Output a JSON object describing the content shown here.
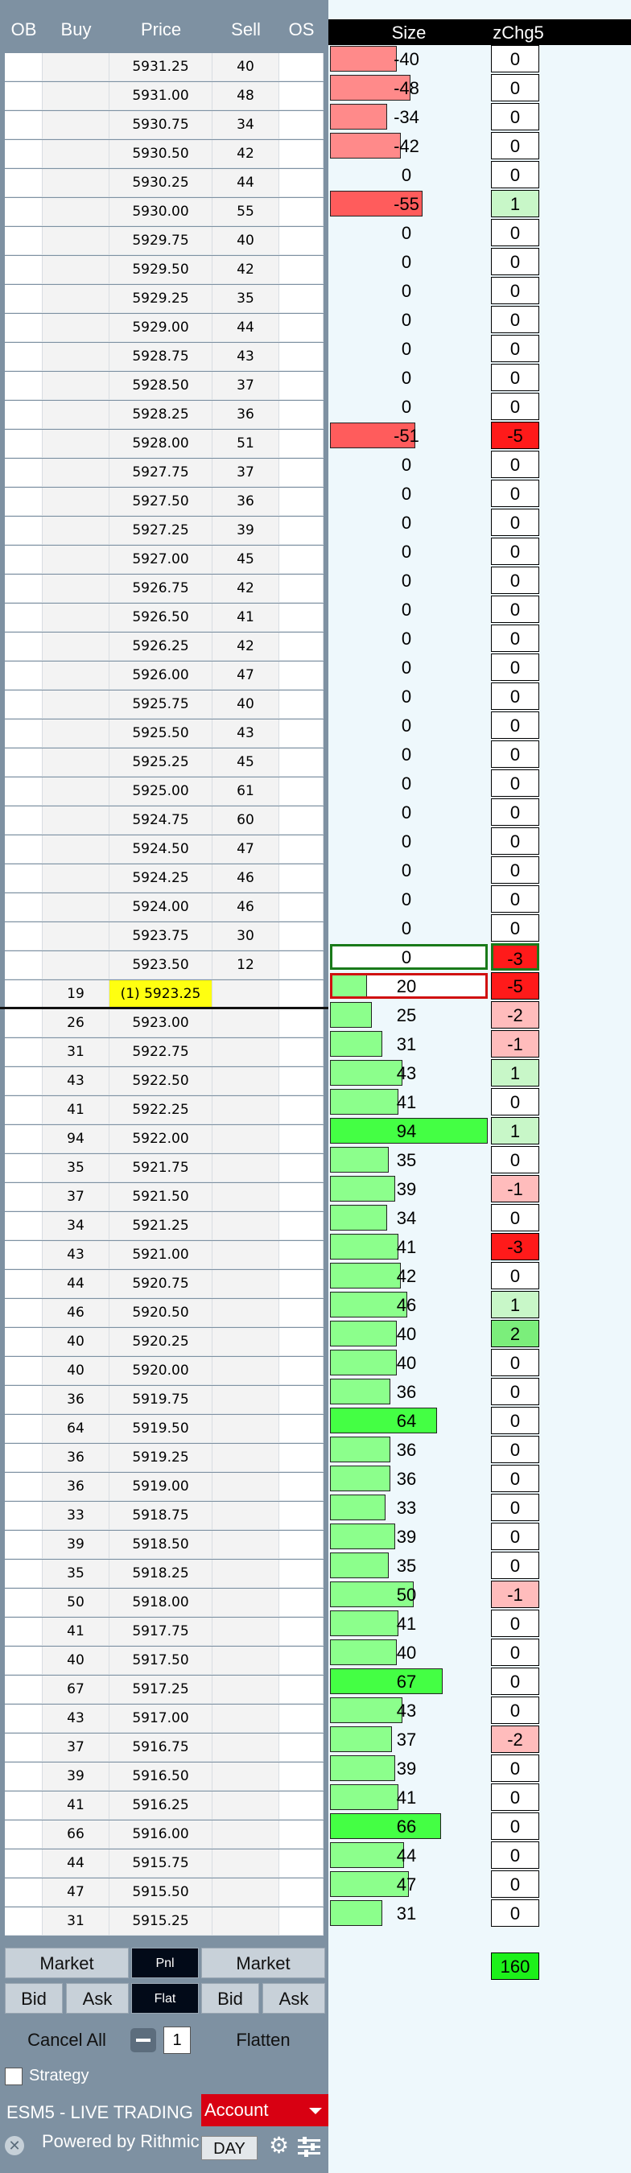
{
  "ladder": {
    "headers": {
      "ob": "OB",
      "buy": "Buy",
      "price": "Price",
      "sell": "Sell",
      "os": "OS"
    },
    "asks": [
      [
        "5931.25",
        "40"
      ],
      [
        "5931.00",
        "48"
      ],
      [
        "5930.75",
        "34"
      ],
      [
        "5930.50",
        "42"
      ],
      [
        "5930.25",
        "44"
      ],
      [
        "5930.00",
        "55"
      ],
      [
        "5929.75",
        "40"
      ],
      [
        "5929.50",
        "42"
      ],
      [
        "5929.25",
        "35"
      ],
      [
        "5929.00",
        "44"
      ],
      [
        "5928.75",
        "43"
      ],
      [
        "5928.50",
        "37"
      ],
      [
        "5928.25",
        "36"
      ],
      [
        "5928.00",
        "51"
      ],
      [
        "5927.75",
        "37"
      ],
      [
        "5927.50",
        "36"
      ],
      [
        "5927.25",
        "39"
      ],
      [
        "5927.00",
        "45"
      ],
      [
        "5926.75",
        "42"
      ],
      [
        "5926.50",
        "41"
      ],
      [
        "5926.25",
        "42"
      ],
      [
        "5926.00",
        "47"
      ],
      [
        "5925.75",
        "40"
      ],
      [
        "5925.50",
        "43"
      ],
      [
        "5925.25",
        "45"
      ],
      [
        "5925.00",
        "61"
      ],
      [
        "5924.75",
        "60"
      ],
      [
        "5924.50",
        "47"
      ],
      [
        "5924.25",
        "46"
      ],
      [
        "5924.00",
        "46"
      ],
      [
        "5923.75",
        "30"
      ],
      [
        "5923.50",
        "12"
      ]
    ],
    "last": {
      "buy": "19",
      "price": "(1) 5923.25"
    },
    "bids": [
      [
        "26",
        "5923.00"
      ],
      [
        "31",
        "5922.75"
      ],
      [
        "43",
        "5922.50"
      ],
      [
        "41",
        "5922.25"
      ],
      [
        "94",
        "5922.00"
      ],
      [
        "35",
        "5921.75"
      ],
      [
        "37",
        "5921.50"
      ],
      [
        "34",
        "5921.25"
      ],
      [
        "43",
        "5921.00"
      ],
      [
        "44",
        "5920.75"
      ],
      [
        "46",
        "5920.50"
      ],
      [
        "40",
        "5920.25"
      ],
      [
        "40",
        "5920.00"
      ],
      [
        "36",
        "5919.75"
      ],
      [
        "64",
        "5919.50"
      ],
      [
        "36",
        "5919.25"
      ],
      [
        "36",
        "5919.00"
      ],
      [
        "33",
        "5918.75"
      ],
      [
        "39",
        "5918.50"
      ],
      [
        "35",
        "5918.25"
      ],
      [
        "50",
        "5918.00"
      ],
      [
        "41",
        "5917.75"
      ],
      [
        "40",
        "5917.50"
      ],
      [
        "67",
        "5917.25"
      ],
      [
        "43",
        "5917.00"
      ],
      [
        "37",
        "5916.75"
      ],
      [
        "39",
        "5916.50"
      ],
      [
        "41",
        "5916.25"
      ],
      [
        "66",
        "5916.00"
      ],
      [
        "44",
        "5915.75"
      ],
      [
        "47",
        "5915.50"
      ],
      [
        "31",
        "5915.25"
      ]
    ]
  },
  "stats": {
    "headers": {
      "size": "Size",
      "zchg": "zChg5"
    },
    "size_values": [
      -40,
      -48,
      -34,
      -42,
      0,
      -55,
      0,
      0,
      0,
      0,
      0,
      0,
      0,
      -51,
      0,
      0,
      0,
      0,
      0,
      0,
      0,
      0,
      0,
      0,
      0,
      0,
      0,
      0,
      0,
      0,
      0,
      0,
      20,
      25,
      31,
      43,
      41,
      94,
      35,
      39,
      34,
      41,
      42,
      46,
      40,
      40,
      36,
      64,
      36,
      36,
      33,
      39,
      35,
      50,
      41,
      40,
      67,
      43,
      37,
      39,
      41,
      66,
      44,
      47,
      31
    ],
    "zchg_values": [
      0,
      0,
      0,
      0,
      0,
      1,
      0,
      0,
      0,
      0,
      0,
      0,
      0,
      -5,
      0,
      0,
      0,
      0,
      0,
      0,
      0,
      0,
      0,
      0,
      0,
      0,
      0,
      0,
      0,
      0,
      0,
      -3,
      -5,
      -2,
      -1,
      1,
      0,
      1,
      0,
      -1,
      0,
      -3,
      0,
      1,
      2,
      0,
      0,
      0,
      0,
      0,
      0,
      0,
      0,
      -1,
      0,
      0,
      0,
      0,
      -2,
      0,
      0,
      0,
      0,
      0,
      0
    ],
    "zchg_total": "160"
  },
  "controls": {
    "market_left": "Market",
    "pnl": "Pnl",
    "market_right": "Market",
    "bid_left": "Bid",
    "ask_left": "Ask",
    "flat": "Flat",
    "bid_right": "Bid",
    "ask_right": "Ask",
    "cancel_all": "Cancel All",
    "quantity": "1",
    "flatten": "Flatten",
    "strategy": "Strategy",
    "account_line": "ESM5 - LIVE TRADING",
    "account_button": "Account",
    "powered_by": "Powered by Rithmic",
    "day": "DAY"
  },
  "colors": {
    "ask_bar": "#ff8a8a",
    "ask_bar_strong": "#ff5c5c",
    "bid_bar": "#8cff8c",
    "bid_bar_strong": "#44ff44",
    "zchg_neg_strong": "#ff1a1a",
    "zchg_neg_weak": "#ffbcbc",
    "zchg_pos": "#c8f7c8",
    "zchg_pos_strong": "#7bee7b"
  }
}
